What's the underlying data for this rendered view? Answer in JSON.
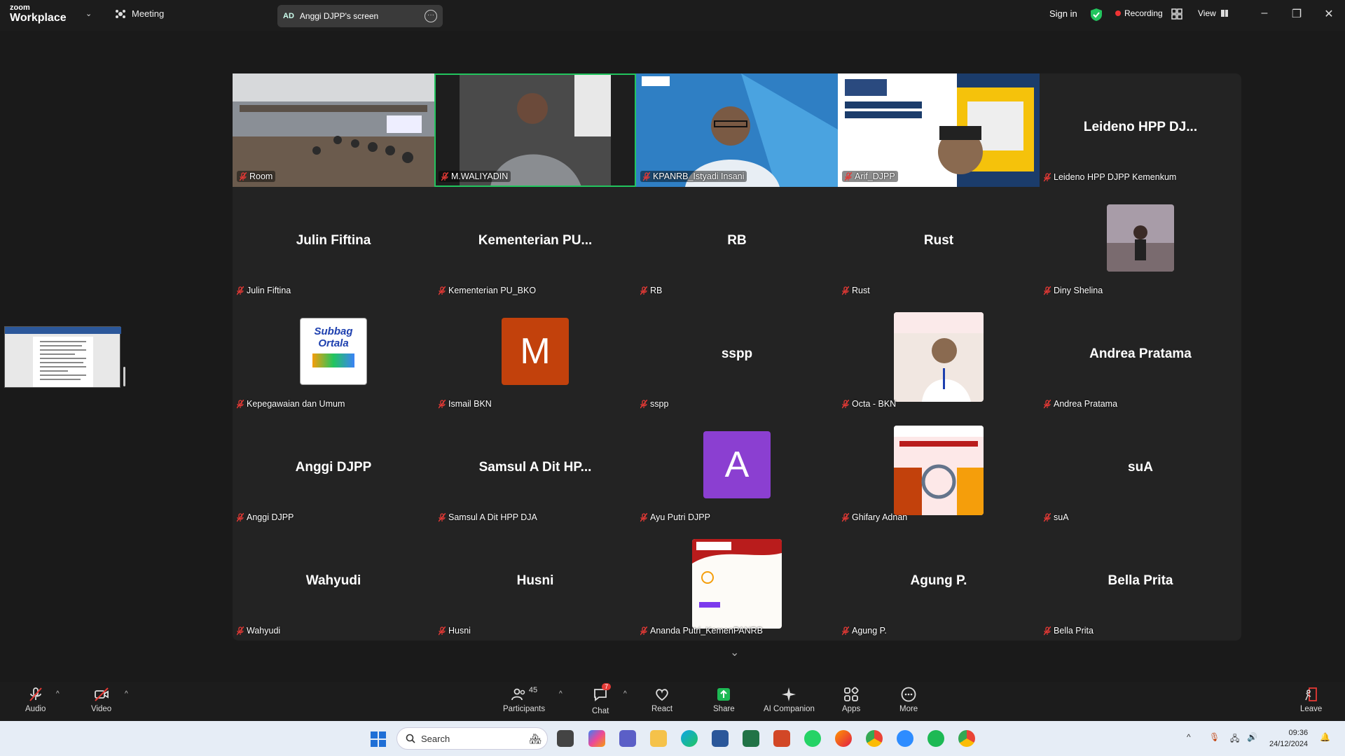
{
  "titlebar": {
    "logo_top": "zoom",
    "logo_bottom": "Workplace",
    "meeting_label": "Meeting",
    "share_initials": "AD",
    "share_label": "Anggi DJPP's screen",
    "sign_in": "Sign in",
    "recording": "Recording",
    "view": "View"
  },
  "tiles": [
    {
      "label": "Room",
      "kind": "video",
      "scene": "room"
    },
    {
      "label": "M.WALIYADIN",
      "kind": "video",
      "scene": "car",
      "active": true
    },
    {
      "label": "KPANRB_Istyadi Insani",
      "kind": "video",
      "scene": "panrb"
    },
    {
      "label": "Arif_DJPP",
      "kind": "video",
      "scene": "djpp"
    },
    {
      "label": "Leideno HPP DJPP Kemenkum",
      "big": "Leideno HPP DJ..."
    },
    {
      "label": "Julin Fiftina",
      "big": "Julin Fiftina"
    },
    {
      "label": "Kementerian PU_BKO",
      "big": "Kementerian PU..."
    },
    {
      "label": "RB",
      "big": "RB"
    },
    {
      "label": "Rust",
      "big": "Rust"
    },
    {
      "label": "Diny Shelina",
      "kind": "photo",
      "photo": "diny"
    },
    {
      "label": "Kepegawaian dan Umum",
      "kind": "photo",
      "photo": "subbag",
      "photo_text_1": "Subbag",
      "photo_text_2": "Ortala"
    },
    {
      "label": "Ismail BKN",
      "kind": "letter",
      "letter": "M",
      "color": "#c2410c"
    },
    {
      "label": "sspp",
      "big": "sspp"
    },
    {
      "label": "Octa - BKN",
      "kind": "photo",
      "photo": "octa"
    },
    {
      "label": "Andrea Pratama",
      "big": "Andrea Pratama"
    },
    {
      "label": "Anggi DJPP",
      "big": "Anggi DJPP"
    },
    {
      "label": "Samsul A Dit HPP DJA",
      "big": "Samsul A Dit HP..."
    },
    {
      "label": "Ayu Putri DJPP",
      "kind": "letter",
      "letter": "A",
      "color": "#8b3fd1"
    },
    {
      "label": "Ghifary Adnan",
      "kind": "photo",
      "photo": "ghifary"
    },
    {
      "label": "suA",
      "big": "suA"
    },
    {
      "label": "Wahyudi",
      "big": "Wahyudi"
    },
    {
      "label": "Husni",
      "big": "Husni"
    },
    {
      "label": "Ananda Putri_KemenPANRB",
      "kind": "photo",
      "photo": "ananda"
    },
    {
      "label": "Agung P.",
      "big": "Agung P."
    },
    {
      "label": "Bella Prita",
      "big": "Bella Prita"
    }
  ],
  "toolbar": {
    "audio": "Audio",
    "video": "Video",
    "participants": "Participants",
    "participants_count": "45",
    "chat": "Chat",
    "chat_badge": "7",
    "react": "React",
    "share": "Share",
    "ai": "AI Companion",
    "apps": "Apps",
    "more": "More",
    "leave": "Leave"
  },
  "taskbar": {
    "search_placeholder": "Search",
    "time": "09:36",
    "date": "24/12/2024"
  },
  "colors": {
    "active_border": "#22c55e",
    "muted": "#e53935",
    "share_green": "#1db954"
  }
}
